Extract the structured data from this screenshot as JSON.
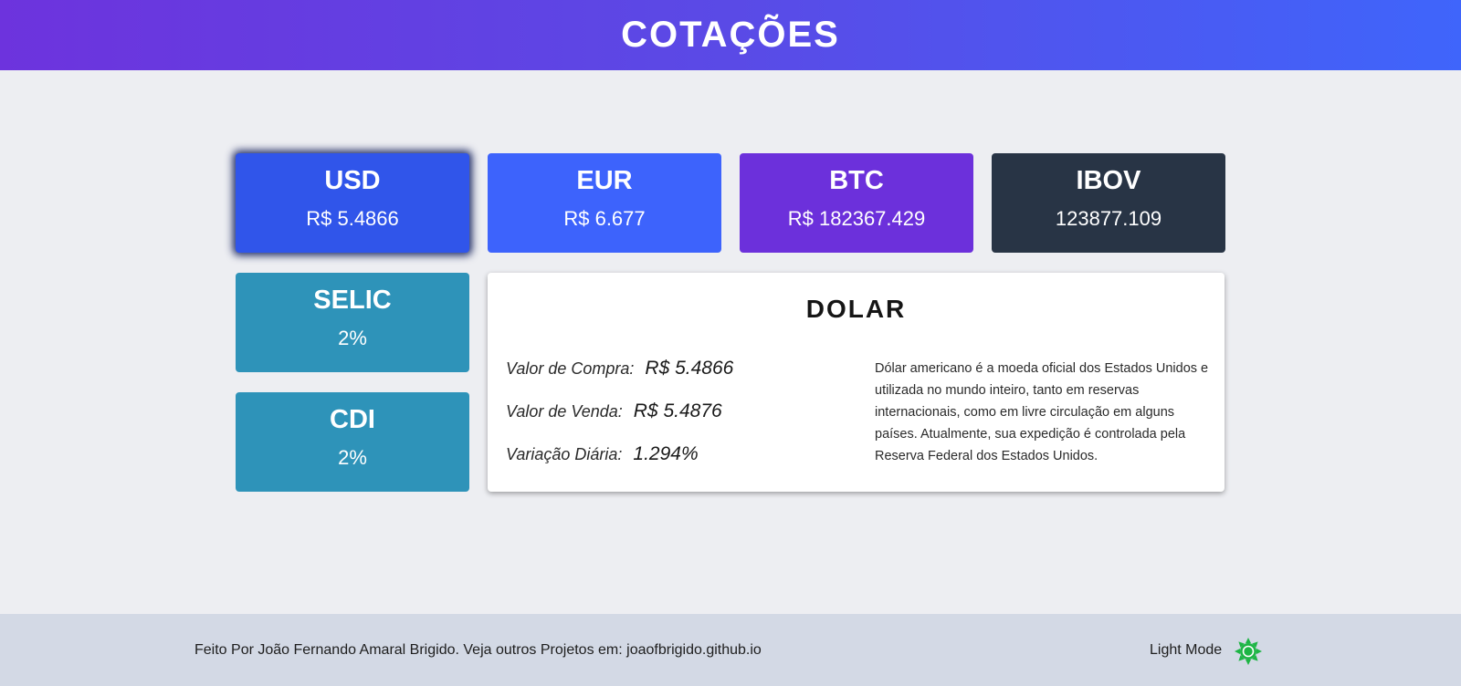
{
  "header": {
    "title": "COTAÇÕES"
  },
  "cards": [
    {
      "code": "USD",
      "value": "R$ 5.4866",
      "color": "#3055ea"
    },
    {
      "code": "EUR",
      "value": "R$ 6.677",
      "color": "#3d63fc"
    },
    {
      "code": "BTC",
      "value": "R$ 182367.429",
      "color": "#6c30db"
    },
    {
      "code": "IBOV",
      "value": "123877.109",
      "color": "#283445"
    },
    {
      "code": "SELIC",
      "value": "2%",
      "color": "#2e93b9"
    },
    {
      "code": "CDI",
      "value": "2%",
      "color": "#2e93b9"
    }
  ],
  "detail": {
    "title": "DOLAR",
    "buy_label": "Valor de Compra:",
    "buy_value": "R$ 5.4866",
    "sell_label": "Valor de Venda:",
    "sell_value": "R$ 5.4876",
    "var_label": "Variação Diária:",
    "var_value": "1.294%",
    "description": "Dólar americano é a moeda oficial dos Estados Unidos e utilizada no mundo inteiro, tanto em reservas internacionais, como em livre circulação em alguns países. Atualmente, sua expedição é controlada pela Reserva Federal dos Estados Unidos."
  },
  "footer": {
    "credit_prefix": "Feito Por João Fernando Amaral Brigido. Veja outros Projetos em: ",
    "credit_link": "joaofbrigido.github.io",
    "mode_label": "Light Mode",
    "mode_icon": "sun-icon",
    "mode_icon_color": "#1db544"
  }
}
